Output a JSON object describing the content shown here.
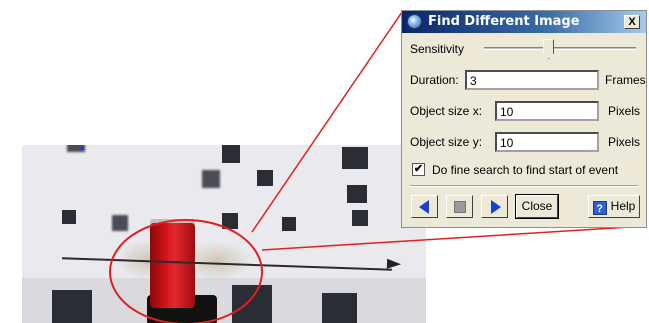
{
  "dialog": {
    "title": "Find Different Image",
    "close_glyph": "X",
    "sensitivity_label": "Sensitivity",
    "sensitivity_level": 0.42,
    "duration_label": "Duration:",
    "duration_value": "3",
    "duration_unit": "Frames",
    "object_x_label": "Object size x:",
    "object_x_value": "10",
    "object_x_unit": "Pixels",
    "object_y_label": "Object size y:",
    "object_y_value": "10",
    "object_y_unit": "Pixels",
    "fine_search_label": "Do fine search to find start of event",
    "fine_search_checked": true,
    "check_glyph": "✔",
    "buttons": {
      "prev_icon": "triangle-left",
      "stop_icon": "stop-square",
      "next_icon": "triangle-right",
      "close_label": "Close",
      "help_glyph": "?",
      "help_label": "Help"
    }
  },
  "colors": {
    "titlebar_start": "#0a246a",
    "titlebar_end": "#a6caf0",
    "dialog_bg": "#ece9d8",
    "callout_red": "#e02020",
    "nav_blue": "#1a3fd6"
  }
}
